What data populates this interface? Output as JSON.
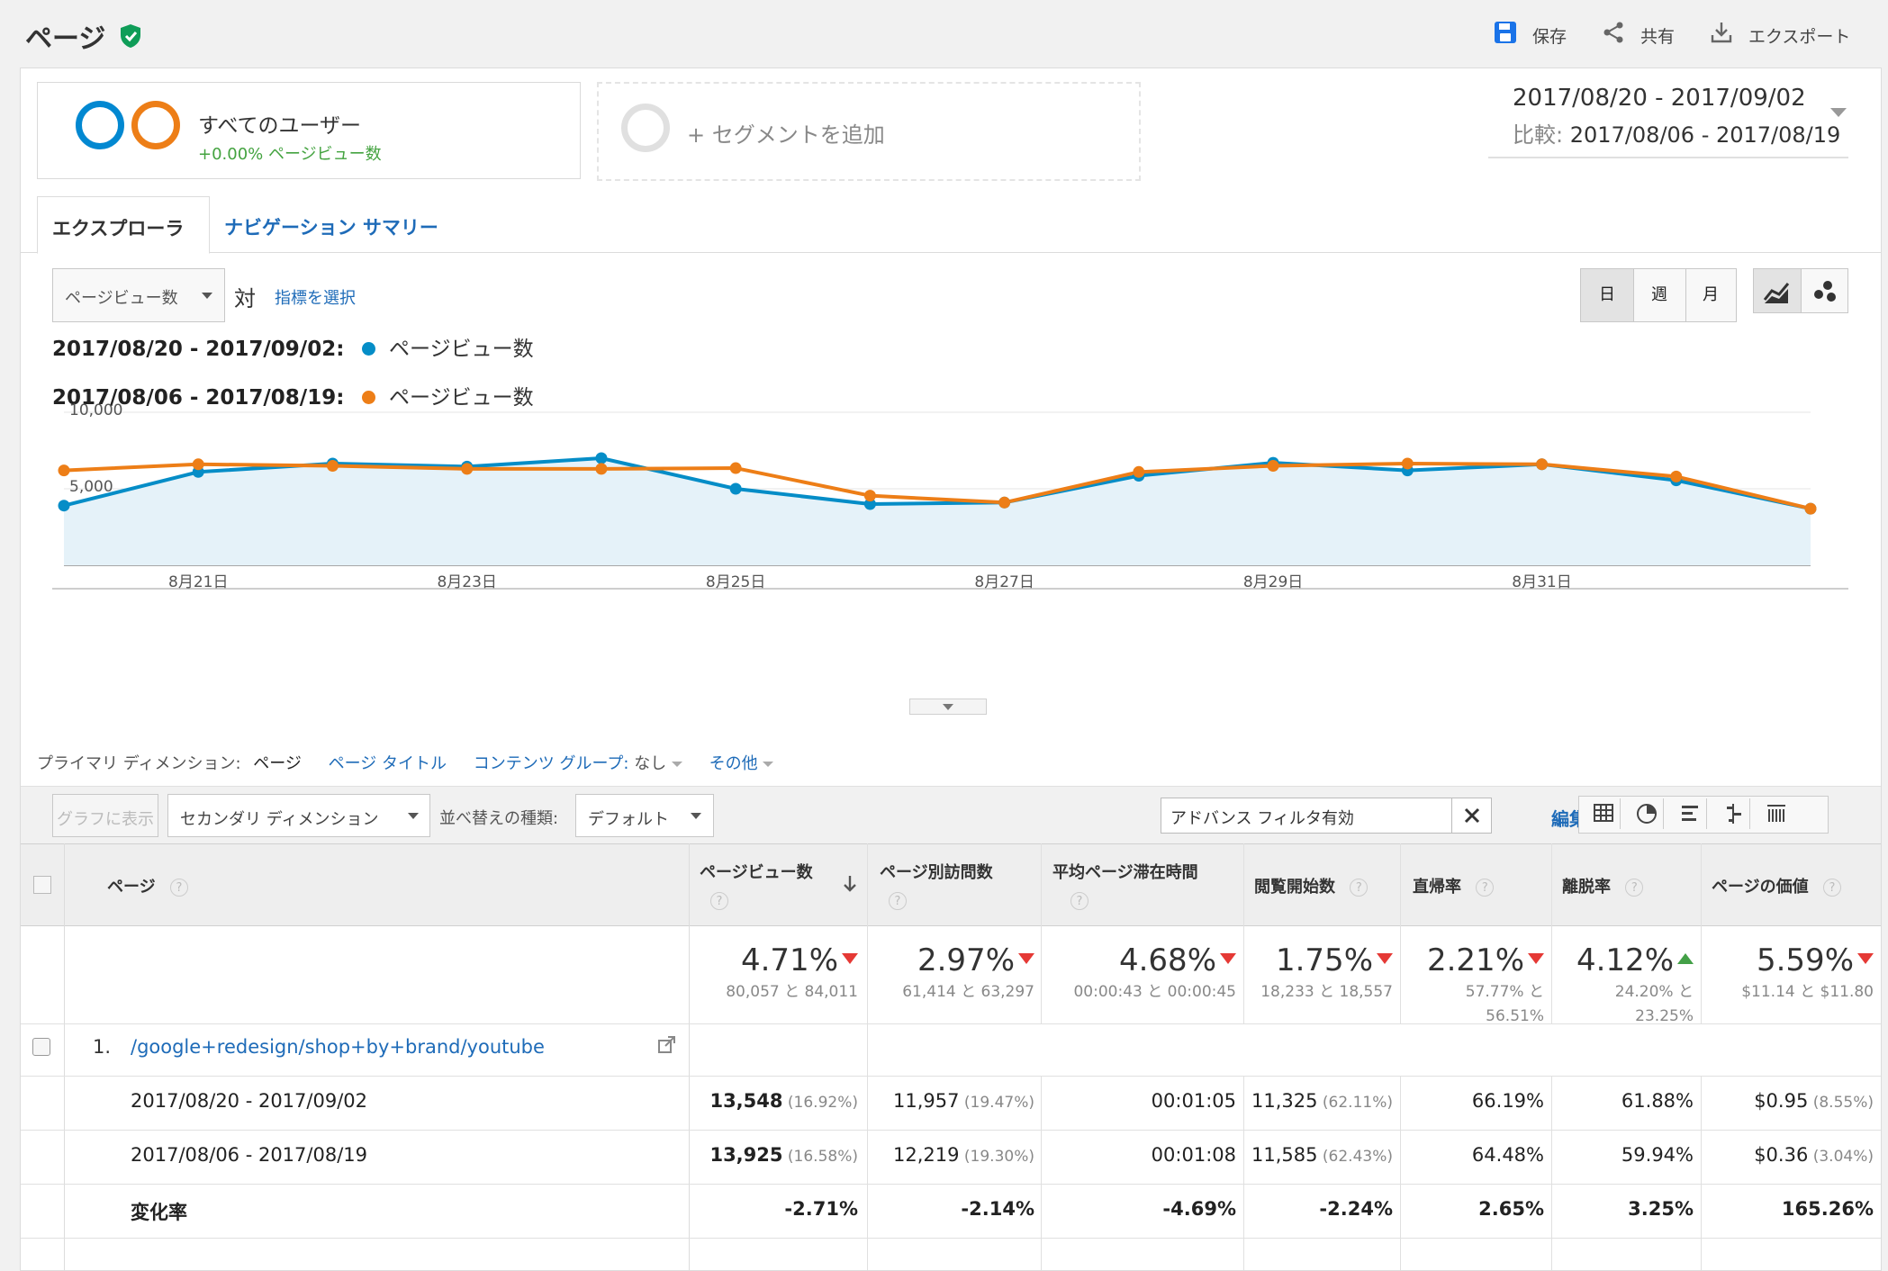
{
  "header": {
    "title": "ページ",
    "save": "保存",
    "share": "共有",
    "export": "エクスポート"
  },
  "segments": {
    "all_users": "すべてのユーザー",
    "all_users_sub": "+0.00% ページビュー数",
    "add_segment": "+ セグメントを追加"
  },
  "date": {
    "range": "2017/08/20 - 2017/09/02",
    "compare_label": "比較:",
    "compare_range": "2017/08/06 - 2017/08/19"
  },
  "tabs": [
    "エクスプローラ",
    "ナビゲーション サマリー"
  ],
  "metric_select": {
    "value": "ページビュー数",
    "vs": "対",
    "choose": "指標を選択"
  },
  "granularity": [
    "日",
    "週",
    "月"
  ],
  "legend": [
    {
      "range": "2017/08/20 - 2017/09/02:",
      "label": "ページビュー数",
      "color": "#058dc7"
    },
    {
      "range": "2017/08/06 - 2017/08/19:",
      "label": "ページビュー数",
      "color": "#ed7e17"
    }
  ],
  "chart_data": {
    "type": "line",
    "x": [
      "8/20",
      "8/21",
      "8/22",
      "8/23",
      "8/24",
      "8/25",
      "8/26",
      "8/27",
      "8/28",
      "8/29",
      "8/30",
      "8/31",
      "9/1",
      "9/2"
    ],
    "tick_labels": [
      "8月21日",
      "8月23日",
      "8月25日",
      "8月27日",
      "8月29日",
      "8月31日"
    ],
    "tick_indices": [
      1,
      3,
      5,
      7,
      9,
      11
    ],
    "y_ticks": [
      "10,000",
      "5,000"
    ],
    "ylim": [
      0,
      10000
    ],
    "series": [
      {
        "name": "2017/08/20 - 2017/09/02",
        "color": "#058dc7",
        "area": true,
        "values": [
          3900,
          6100,
          6650,
          6450,
          7000,
          5000,
          4000,
          4100,
          5850,
          6700,
          6200,
          6600,
          5550,
          3700
        ]
      },
      {
        "name": "2017/08/06 - 2017/08/19",
        "color": "#ed7e17",
        "area": false,
        "values": [
          6200,
          6600,
          6500,
          6300,
          6300,
          6350,
          4550,
          4100,
          6100,
          6500,
          6650,
          6600,
          5800,
          3700
        ]
      }
    ],
    "grid": true
  },
  "dimensions": {
    "label": "プライマリ ディメンション:",
    "current": "ページ",
    "page_title": "ページ タイトル",
    "content_group": "コンテンツ グループ:",
    "content_group_value": "なし",
    "other": "その他"
  },
  "toolbar": {
    "plot": "グラフに表示",
    "secondary": "セカンダリ ディメンション",
    "sort_label": "並べ替えの種類:",
    "sort_value": "デフォルト",
    "filter_value": "アドバンス フィルタ有効",
    "edit": "編集"
  },
  "table": {
    "columns": [
      "ページ",
      "ページビュー数",
      "ページ別訪問数",
      "平均ページ滞在時間",
      "閲覧開始数",
      "直帰率",
      "離脱率",
      "ページの価値"
    ],
    "summary": [
      {
        "pct": "4.71%",
        "dir": "down",
        "sub": "80,057 と 84,011"
      },
      {
        "pct": "2.97%",
        "dir": "down",
        "sub": "61,414 と 63,297"
      },
      {
        "pct": "4.68%",
        "dir": "down",
        "sub": "00:00:43 と 00:00:45"
      },
      {
        "pct": "1.75%",
        "dir": "down",
        "sub": "18,233 と 18,557"
      },
      {
        "pct": "2.21%",
        "dir": "down",
        "sub": "57.77% と",
        "sub2": "56.51%"
      },
      {
        "pct": "4.12%",
        "dir": "up",
        "sub": "24.20% と",
        "sub2": "23.25%"
      },
      {
        "pct": "5.59%",
        "dir": "down",
        "sub": "$11.14 と $11.80"
      }
    ],
    "row1": {
      "index": "1.",
      "page": "/google+redesign/shop+by+brand/youtube",
      "rows": [
        {
          "label": "2017/08/20 - 2017/09/02",
          "cells": [
            {
              "v": "13,548",
              "p": "(16.92%)",
              "bold": true
            },
            {
              "v": "11,957",
              "p": "(19.47%)"
            },
            {
              "v": "00:01:05",
              "p": ""
            },
            {
              "v": "11,325",
              "p": "(62.11%)"
            },
            {
              "v": "66.19%",
              "p": ""
            },
            {
              "v": "61.88%",
              "p": ""
            },
            {
              "v": "$0.95",
              "p": "(8.55%)"
            }
          ]
        },
        {
          "label": "2017/08/06 - 2017/08/19",
          "cells": [
            {
              "v": "13,925",
              "p": "(16.58%)",
              "bold": true
            },
            {
              "v": "12,219",
              "p": "(19.30%)"
            },
            {
              "v": "00:01:08",
              "p": ""
            },
            {
              "v": "11,585",
              "p": "(62.43%)"
            },
            {
              "v": "64.48%",
              "p": ""
            },
            {
              "v": "59.94%",
              "p": ""
            },
            {
              "v": "$0.36",
              "p": "(3.04%)"
            }
          ]
        },
        {
          "label": "変化率",
          "bold": true,
          "cells": [
            {
              "v": "-2.71%",
              "p": "",
              "bold": true
            },
            {
              "v": "-2.14%",
              "p": "",
              "bold": true
            },
            {
              "v": "-4.69%",
              "p": "",
              "bold": true
            },
            {
              "v": "-2.24%",
              "p": "",
              "bold": true
            },
            {
              "v": "2.65%",
              "p": "",
              "bold": true
            },
            {
              "v": "3.25%",
              "p": "",
              "bold": true
            },
            {
              "v": "165.26%",
              "p": "",
              "bold": true
            }
          ]
        }
      ]
    }
  }
}
